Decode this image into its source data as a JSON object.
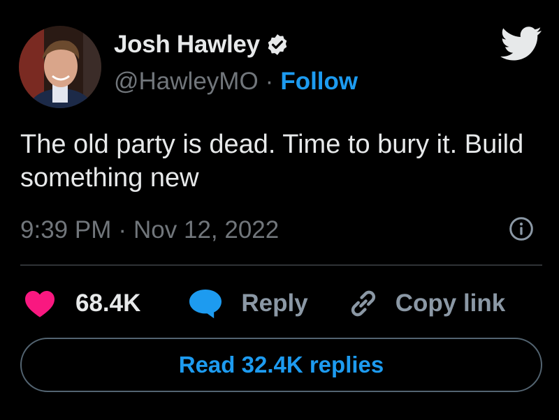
{
  "author": {
    "name": "Josh Hawley",
    "handle": "@HawleyMO",
    "separator": "·",
    "follow_label": "Follow",
    "verified": true
  },
  "tweet": {
    "text": "The old party is dead. Time to bury it. Build\nsomething new",
    "time": "9:39 PM",
    "separator": "·",
    "date": "Nov 12, 2022"
  },
  "actions": {
    "like_count": "68.4K",
    "reply_label": "Reply",
    "copy_link_label": "Copy link"
  },
  "replies_button": {
    "label": "Read 32.4K replies"
  },
  "icons": {
    "logo": "twitter-bird-icon",
    "verified": "verified-badge-icon",
    "info": "info-icon",
    "like": "heart-icon",
    "reply": "speech-bubble-icon",
    "copy": "link-icon"
  },
  "colors": {
    "background": "#000000",
    "text": "#e7e9ea",
    "secondary": "#71767b",
    "accent": "#1d9bf0",
    "like": "#f91880",
    "divider": "#2f3336"
  }
}
